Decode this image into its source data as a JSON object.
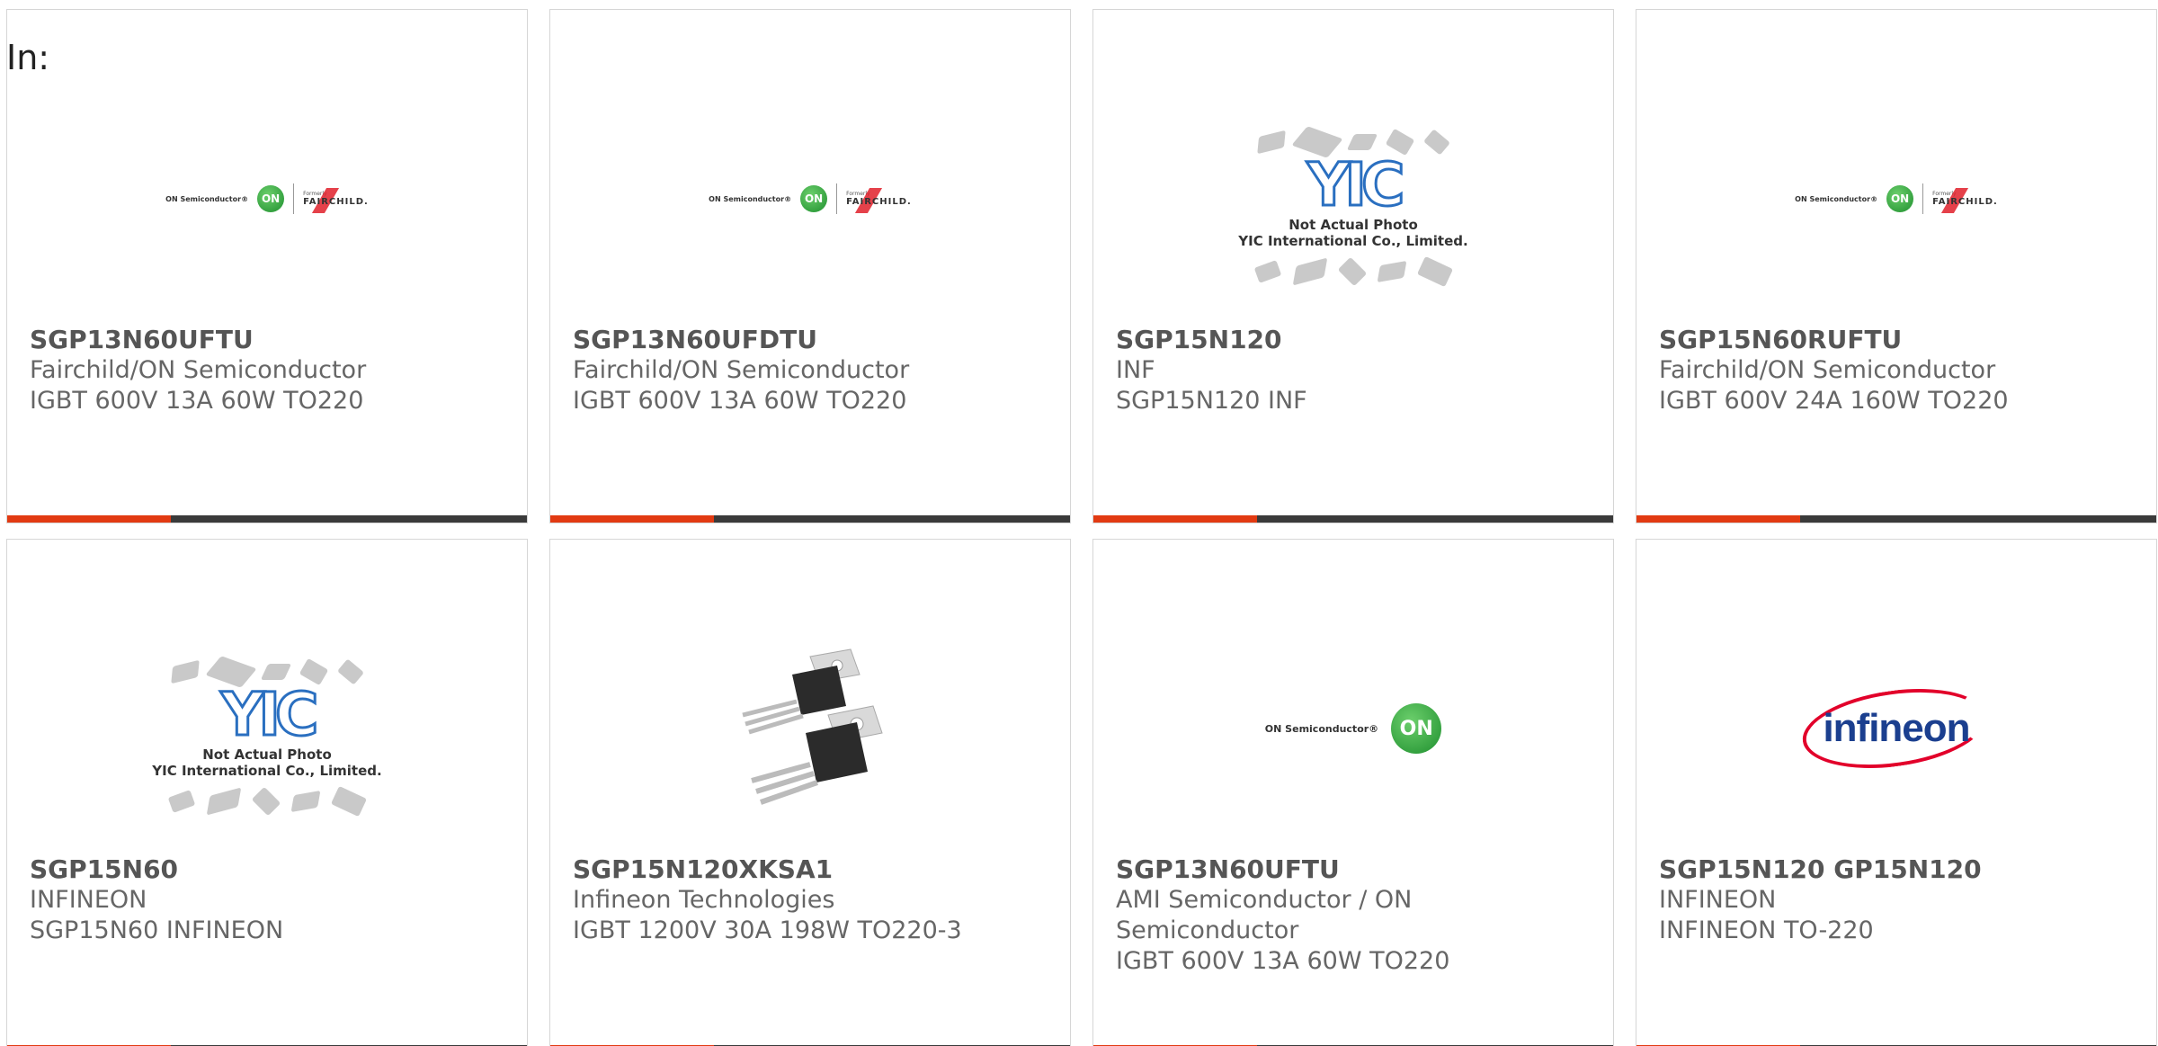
{
  "header": {
    "label": "In:"
  },
  "cards": [
    {
      "part": "SGP13N60UFTU",
      "manufacturer": "Fairchild/ON Semiconductor",
      "description": "IGBT 600V 13A 60W TO220",
      "image": "on-fairchild-logo",
      "logo_text": {
        "on_semi": "ON Semiconductor®",
        "on": "ON",
        "formerly": "Formerly",
        "fairchild": "FAIRCHILD."
      }
    },
    {
      "part": "SGP13N60UFDTU",
      "manufacturer": "Fairchild/ON Semiconductor",
      "description": "IGBT 600V 13A 60W TO220",
      "image": "on-fairchild-logo",
      "logo_text": {
        "on_semi": "ON Semiconductor®",
        "on": "ON",
        "formerly": "Formerly",
        "fairchild": "FAIRCHILD."
      }
    },
    {
      "part": "SGP15N120",
      "manufacturer": "INF",
      "description": "SGP15N120 INF",
      "image": "yic-not-actual-photo",
      "logo_text": {
        "yic": "YIC",
        "line1": "Not Actual Photo",
        "line2": "YIC International Co., Limited."
      }
    },
    {
      "part": "SGP15N60RUFTU",
      "manufacturer": "Fairchild/ON Semiconductor",
      "description": "IGBT 600V 24A 160W TO220",
      "image": "on-fairchild-logo",
      "logo_text": {
        "on_semi": "ON Semiconductor®",
        "on": "ON",
        "formerly": "Formerly",
        "fairchild": "FAIRCHILD."
      }
    },
    {
      "part": "SGP15N60",
      "manufacturer": "INFINEON",
      "description": "SGP15N60 INFINEON",
      "image": "yic-not-actual-photo",
      "logo_text": {
        "yic": "YIC",
        "line1": "Not Actual Photo",
        "line2": "YIC International Co., Limited."
      }
    },
    {
      "part": "SGP15N120XKSA1",
      "manufacturer": "Infineon Technologies",
      "description": "IGBT 1200V 30A 198W TO220-3",
      "image": "to220-package-photo"
    },
    {
      "part": "SGP13N60UFTU",
      "manufacturer": "AMI Semiconductor / ON Semiconductor",
      "description": "IGBT 600V 13A 60W TO220",
      "image": "on-semiconductor-logo",
      "logo_text": {
        "on_semi": "ON Semiconductor®",
        "on": "ON"
      }
    },
    {
      "part": "SGP15N120 GP15N120",
      "manufacturer": "INFINEON",
      "description": "INFINEON TO-220",
      "image": "infineon-logo",
      "logo_text": {
        "infineon": "infineon"
      }
    }
  ],
  "colors": {
    "accent": "#e23a12",
    "bar": "#3a3a3a",
    "border": "#d6d6d6"
  }
}
